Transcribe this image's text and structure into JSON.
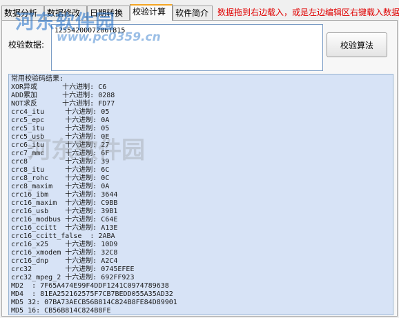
{
  "tabs": [
    {
      "label": "数据分析",
      "active": false
    },
    {
      "label": "数据修改",
      "active": false
    },
    {
      "label": "日期转换",
      "active": false
    },
    {
      "label": "校验计算",
      "active": true
    },
    {
      "label": "软件简介",
      "active": false
    }
  ],
  "hint": "数据拖到右边载入，或是左边编辑区右键载入数据",
  "input": {
    "label": "校验数据:",
    "value": "1255420007206T815"
  },
  "button": {
    "label": "校验算法"
  },
  "output": {
    "heading": "常用校验码结果:",
    "lines": [
      "XOR异或      十六进制: C6",
      "ADD累加      十六进制: 0288",
      "NOT求反      十六进制: FD77",
      "crc4_itu     十六进制: 05",
      "crc5_epc     十六进制: 0A",
      "crc5_itu     十六进制: 05",
      "crc5_usb     十六进制: 0E",
      "crc6_itu     十六进制: 27",
      "crc7_mmc     十六进制: 6F",
      "crc8         十六进制: 39",
      "crc8_itu     十六进制: 6C",
      "crc8_rohc    十六进制: 0C",
      "crc8_maxim   十六进制: 0A",
      "crc16_ibm    十六进制: 3644",
      "crc16_maxim  十六进制: C9BB",
      "crc16_usb    十六进制: 39B1",
      "crc16_modbus 十六进制: C64E",
      "crc16_ccitt  十六进制: A13E",
      "crc16_ccitt_false  : 2ABA",
      "crc16_x25    十六进制: 10D9",
      "crc16_xmodem 十六进制: 32C8",
      "crc16_dnp    十六进制: A2C4",
      "crc32        十六进制: 0745EFEE",
      "crc32_mpeg_2 十六进制: 692FF923",
      "MD2  : 7F65A474E99F4DDF1241C0974789638",
      "MD4  : 81EA252162575F7CB7BEDD055A35AD32",
      "MD5 32: 07BA73AECB56B814C824B8FE84D89901",
      "MD5 16: CB56B814C824B8FE"
    ]
  },
  "watermark": {
    "title": "河东软件园",
    "url": "www.pc0359.cn"
  }
}
